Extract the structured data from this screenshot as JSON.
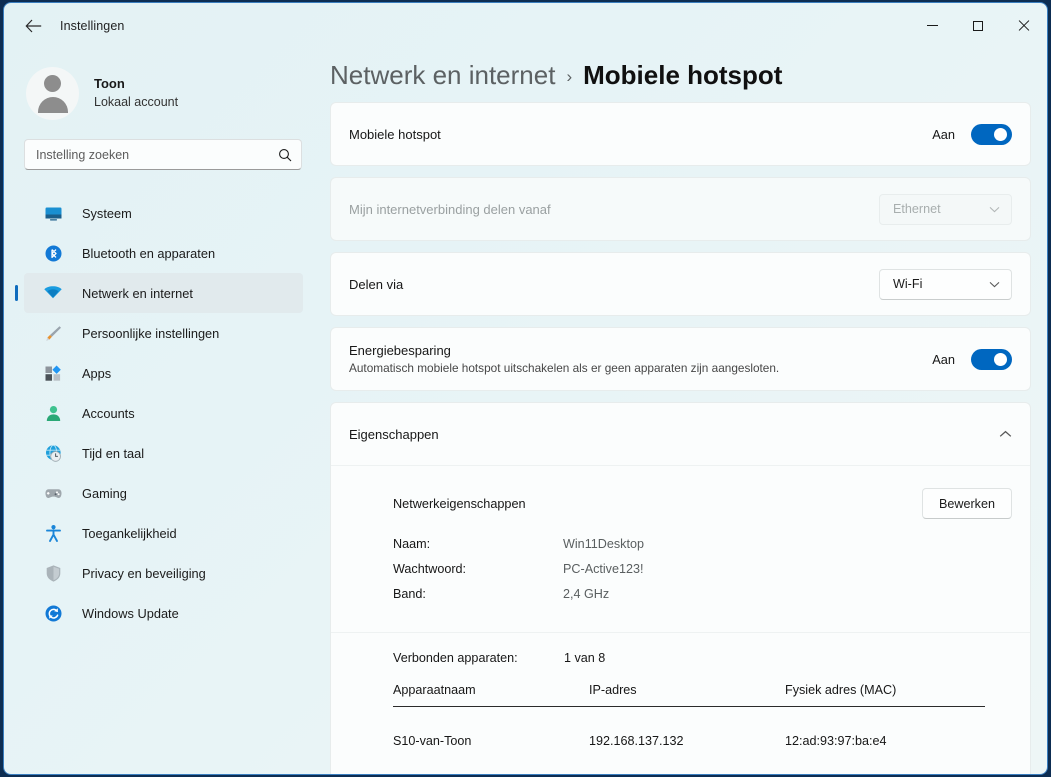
{
  "window": {
    "title": "Instellingen",
    "back_icon": "back-arrow-icon",
    "minimize_label": "Minimaliseren",
    "maximize_label": "Maximaliseren",
    "close_label": "Sluiten"
  },
  "sidebar": {
    "account": {
      "name": "Toon",
      "subtitle": "Lokaal account",
      "avatar_icon": "person-avatar-icon"
    },
    "search": {
      "placeholder": "Instelling zoeken",
      "value": "",
      "icon": "search-icon"
    },
    "items": [
      {
        "label": "Systeem",
        "icon": "monitor-icon",
        "selected": false
      },
      {
        "label": "Bluetooth en apparaten",
        "icon": "bluetooth-icon",
        "selected": false
      },
      {
        "label": "Netwerk en internet",
        "icon": "wifi-icon",
        "selected": true
      },
      {
        "label": "Persoonlijke instellingen",
        "icon": "paintbrush-icon",
        "selected": false
      },
      {
        "label": "Apps",
        "icon": "apps-icon",
        "selected": false
      },
      {
        "label": "Accounts",
        "icon": "person-icon",
        "selected": false
      },
      {
        "label": "Tijd en taal",
        "icon": "clock-globe-icon",
        "selected": false
      },
      {
        "label": "Gaming",
        "icon": "gamepad-icon",
        "selected": false
      },
      {
        "label": "Toegankelijkheid",
        "icon": "accessibility-icon",
        "selected": false
      },
      {
        "label": "Privacy en beveiliging",
        "icon": "shield-icon",
        "selected": false
      },
      {
        "label": "Windows Update",
        "icon": "update-refresh-icon",
        "selected": false
      }
    ]
  },
  "breadcrumb": {
    "parent": "Netwerk en internet",
    "separator": "›",
    "current": "Mobiele hotspot"
  },
  "settings": {
    "hotspot": {
      "title": "Mobiele hotspot",
      "toggle_label": "Aan",
      "toggle_on": true
    },
    "share_from": {
      "title": "Mijn internetverbinding delen vanaf",
      "value": "Ethernet",
      "disabled": true,
      "chevron_icon": "chevron-down-icon"
    },
    "share_via": {
      "title": "Delen via",
      "value": "Wi-Fi",
      "disabled": false,
      "chevron_icon": "chevron-down-icon"
    },
    "power_saving": {
      "title": "Energiebesparing",
      "subtitle": "Automatisch mobiele hotspot uitschakelen als er geen apparaten zijn aangesloten.",
      "toggle_label": "Aan",
      "toggle_on": true
    },
    "properties": {
      "title": "Eigenschappen",
      "expanded": true,
      "chevron_icon": "chevron-up-icon",
      "network_properties": {
        "heading": "Netwerkeigenschappen",
        "edit_button": "Bewerken",
        "rows": [
          {
            "key": "Naam:",
            "value": "Win11Desktop"
          },
          {
            "key": "Wachtwoord:",
            "value": "PC-Active123!"
          },
          {
            "key": "Band:",
            "value": "2,4 GHz"
          }
        ]
      },
      "devices": {
        "count_label": "Verbonden apparaten:",
        "count_value": "1 van 8",
        "columns": [
          "Apparaatnaam",
          "IP-adres",
          "Fysiek adres (MAC)"
        ],
        "rows": [
          [
            "S10-van-Toon",
            "192.168.137.132",
            "12:ad:93:97:ba:e4"
          ]
        ]
      }
    }
  }
}
